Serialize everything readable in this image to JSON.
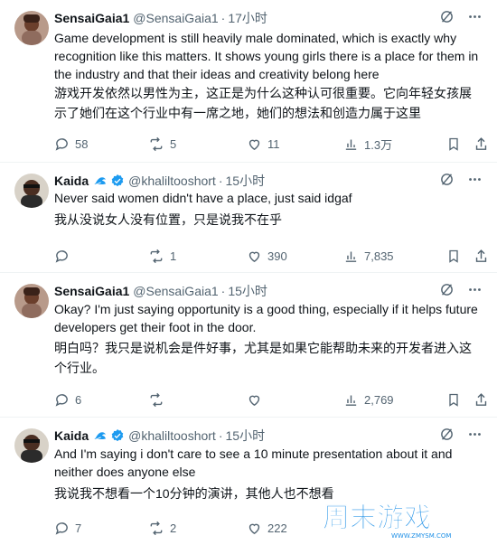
{
  "colors": {
    "text": "#0f1419",
    "muted": "#536471",
    "blue": "#1d9bf0",
    "border": "#eff3f4"
  },
  "tweets": [
    {
      "name": "SensaiGaia1",
      "handle": "@SensaiGaia1",
      "time": "17小时",
      "body": "Game development is still heavily male dominated, which is exactly why recognition like this matters. It shows young girls there is a place for them in the industry and that their ideas and creativity belong here",
      "translation": "游戏开发依然以男性为主，这正是为什么这种认可很重要。它向年轻女孩展示了她们在这个行业中有一席之地，她们的想法和创造力属于这里",
      "replies": "58",
      "reposts": "5",
      "likes": "11",
      "views": "1.3万"
    },
    {
      "name": "Kaida",
      "handle": "@khaliltooshort",
      "time": "15小时",
      "body": "Never said women didn't have a place, just said idgaf",
      "translation": "我从没说女人没有位置，只是说我不在乎",
      "replies": "",
      "reposts": "1",
      "likes": "390",
      "views": "7,835"
    },
    {
      "name": "SensaiGaia1",
      "handle": "@SensaiGaia1",
      "time": "15小时",
      "body": "Okay? I'm just saying opportunity is a good thing, especially if it helps future developers get their foot in the door.",
      "translation": "明白吗？我只是说机会是件好事，尤其是如果它能帮助未来的开发者进入这个行业。",
      "replies": "6",
      "reposts": "",
      "likes": "",
      "views": "2,769"
    },
    {
      "name": "Kaida",
      "handle": "@khaliltooshort",
      "time": "15小时",
      "body": "And I'm saying i don't care to see a 10 minute presentation about it and neither does anyone else",
      "translation": "我说我不想看一个10分钟的演讲，其他人也不想看",
      "replies": "7",
      "reposts": "2",
      "likes": "222",
      "views": ""
    }
  ],
  "watermark": {
    "text": "周末游戏",
    "sub": "WWW.ZMYSM.COM"
  }
}
